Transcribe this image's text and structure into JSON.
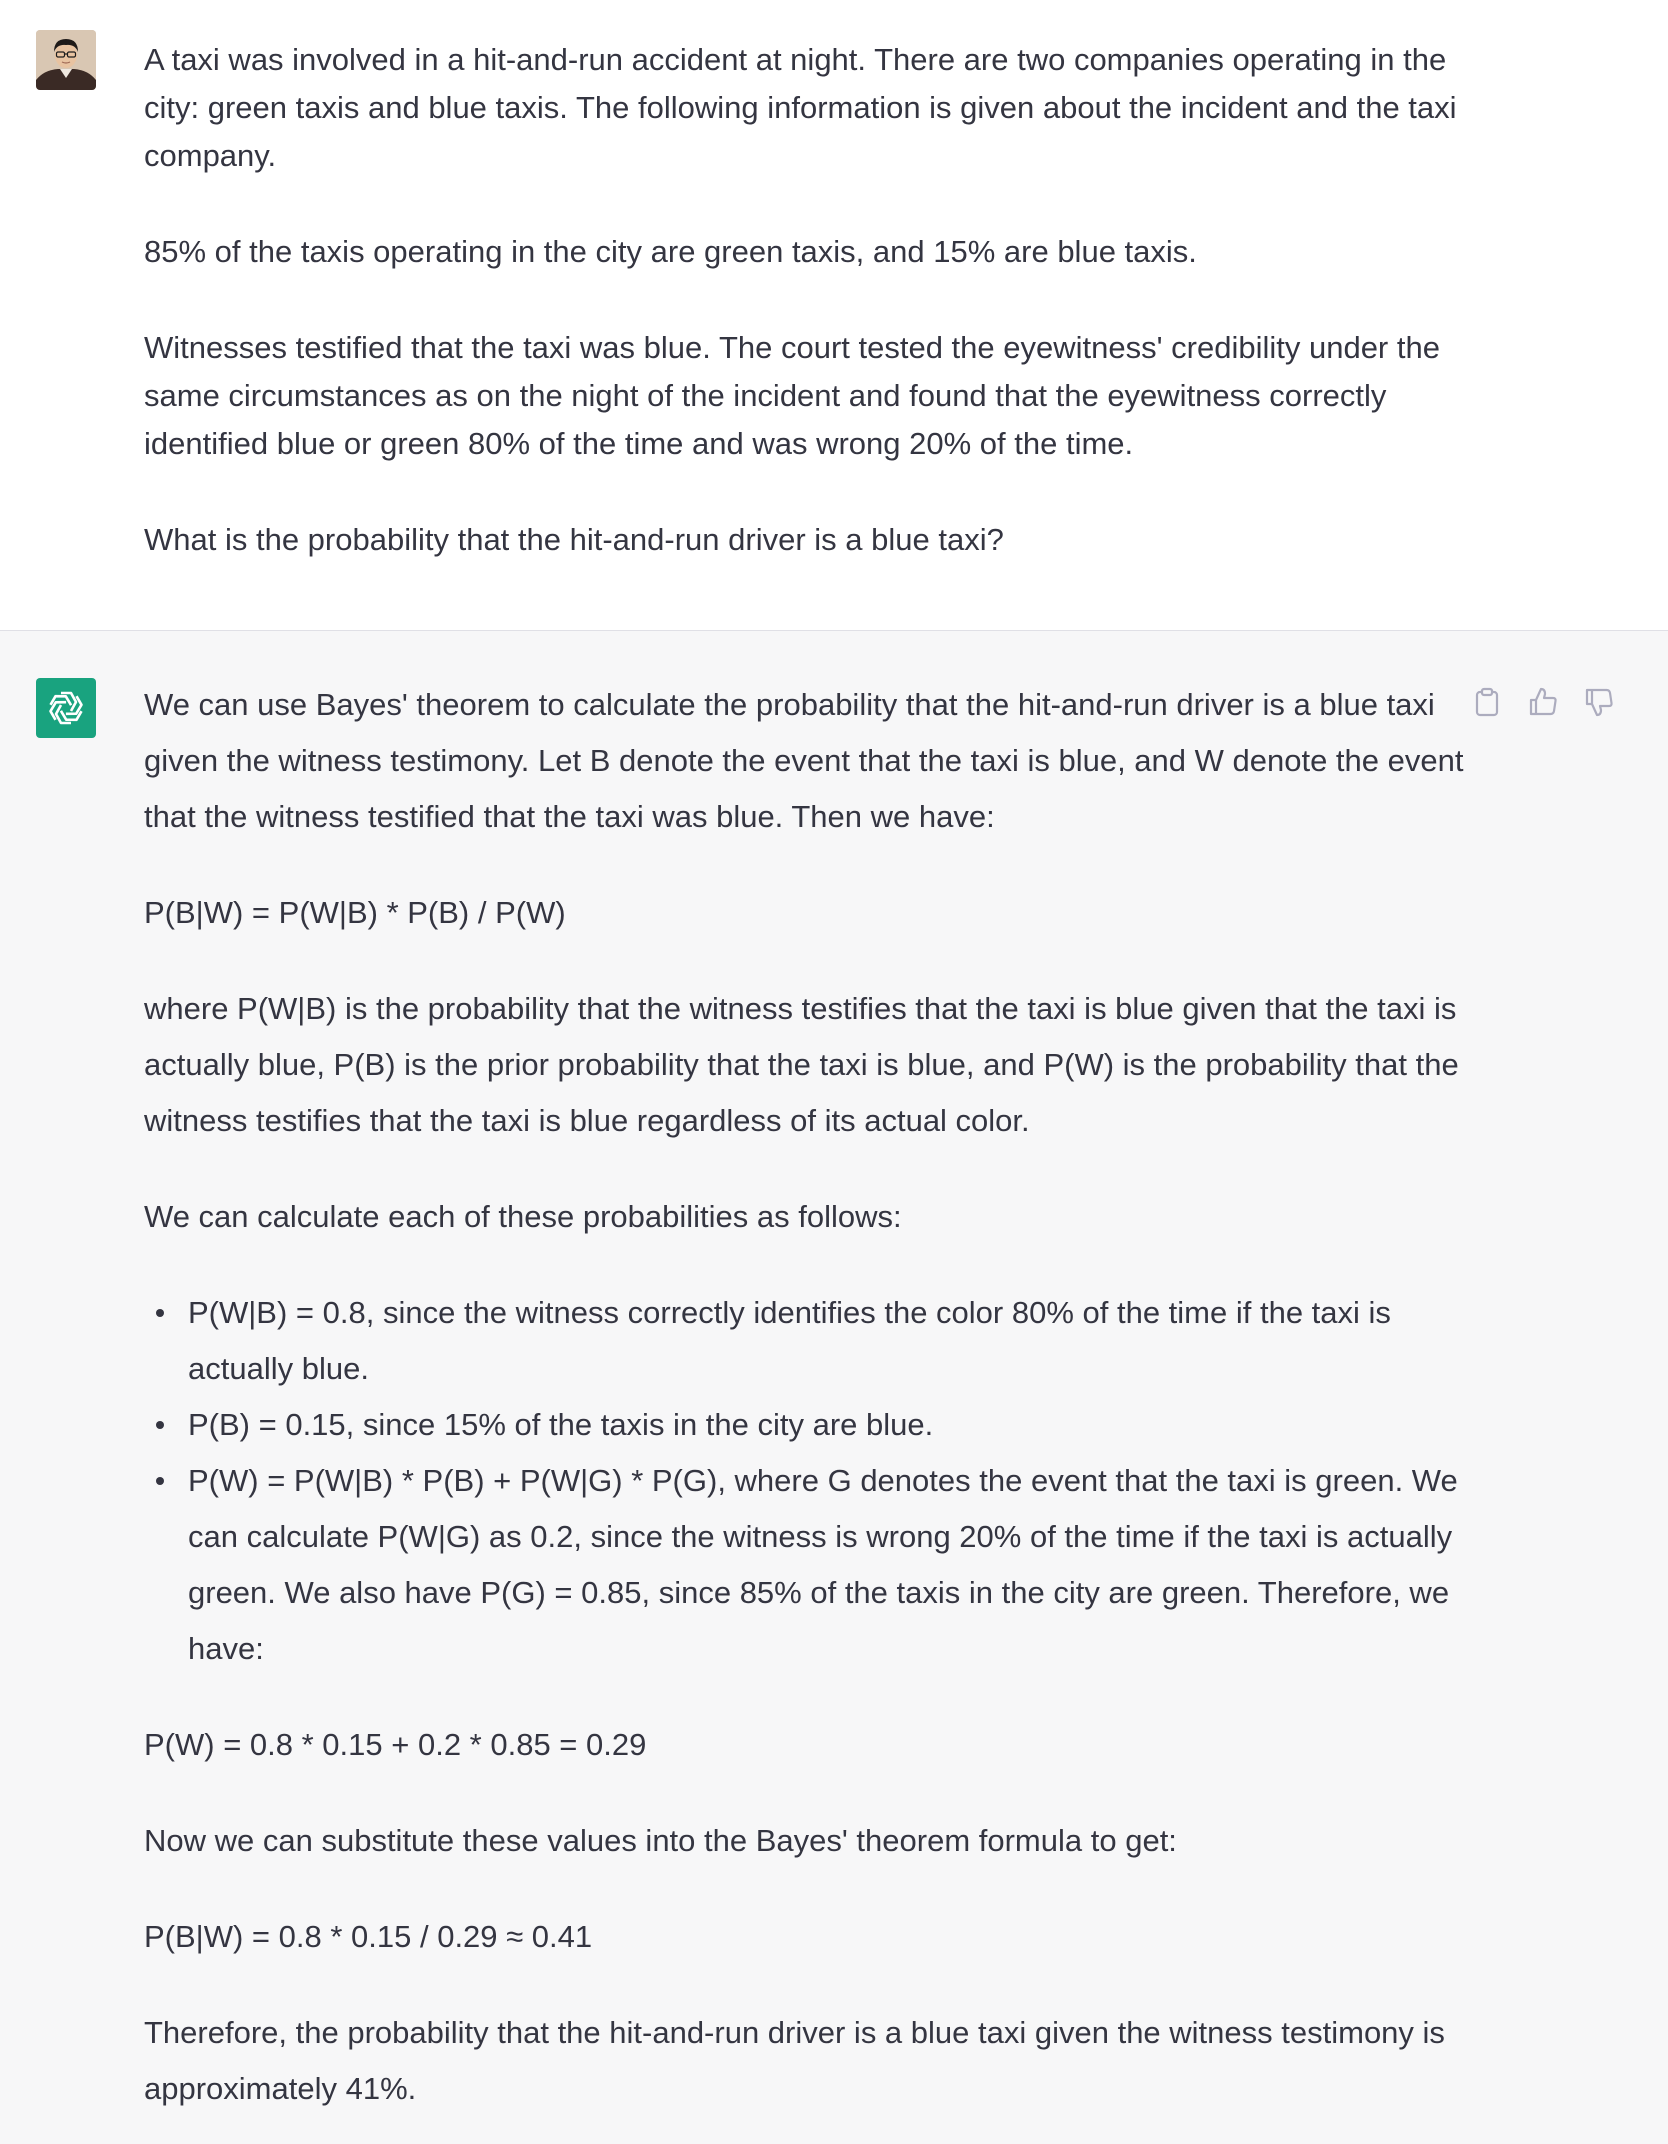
{
  "user_turn": {
    "avatar": "user-avatar-photo",
    "paragraphs": [
      "A taxi was involved in a hit-and-run accident at night. There are two companies operating in the city: green taxis and blue taxis. The following information is given about the incident and the taxi company.",
      "85% of the taxis operating in the city are green taxis, and 15% are blue taxis.",
      "Witnesses testified that the taxi was blue. The court tested the eyewitness' credibility under the same circumstances as on the night of the incident and found that the eyewitness correctly identified blue or green 80% of the time and was wrong 20% of the time.",
      "What is the probability that the hit-and-run driver is a blue taxi?"
    ]
  },
  "assistant_turn": {
    "avatar": "openai-logo-icon",
    "actions": [
      "copy-icon",
      "thumbs-up-icon",
      "thumbs-down-icon"
    ],
    "intro": "We can use Bayes' theorem to calculate the probability that the hit-and-run driver is a blue taxi given the witness testimony. Let B denote the event that the taxi is blue, and W denote the event that the witness testified that the taxi was blue. Then we have:",
    "formula": "P(B|W) = P(W|B) * P(B) / P(W)",
    "explanation": "where P(W|B) is the probability that the witness testifies that the taxi is blue given that the taxi is actually blue, P(B) is the prior probability that the taxi is blue, and P(W) is the probability that the witness testifies that the taxi is blue regardless of its actual color.",
    "lead_in": "We can calculate each of these probabilities as follows:",
    "bullets": [
      "P(W|B) = 0.8, since the witness correctly identifies the color 80% of the time if the taxi is actually blue.",
      "P(B) = 0.15, since 15% of the taxis in the city are blue.",
      "P(W) = P(W|B) * P(B) + P(W|G) * P(G), where G denotes the event that the taxi is green. We can calculate P(W|G) as 0.2, since the witness is wrong 20% of the time if the taxi is actually green. We also have P(G) = 0.85, since 85% of the taxis in the city are green. Therefore, we have:"
    ],
    "pw_calc": "P(W) = 0.8 * 0.15 + 0.2 * 0.85 = 0.29",
    "substitute": "Now we can substitute these values into the Bayes' theorem formula to get:",
    "result_calc": "P(B|W) = 0.8 * 0.15 / 0.29 ≈ 0.41",
    "conclusion": "Therefore, the probability that the hit-and-run driver is a blue taxi given the witness testimony is approximately 41%."
  }
}
